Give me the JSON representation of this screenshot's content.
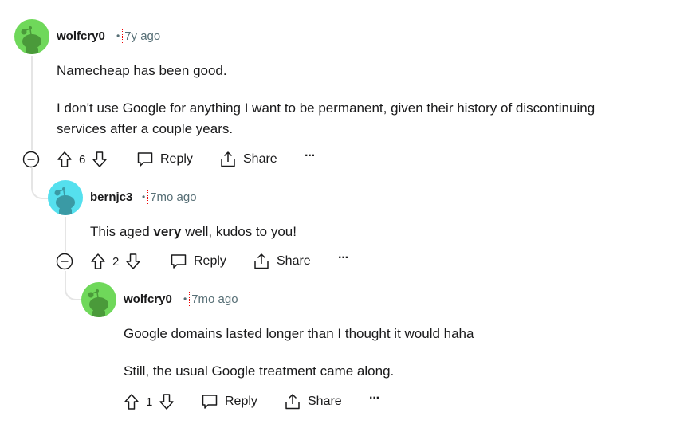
{
  "comments": [
    {
      "author": "wolfcry0",
      "time": "7y ago",
      "avatar_color": "#6fd85a",
      "avatar_fg": "#4a9a3a",
      "paragraphs": [
        "Namecheap has been good.",
        "I don't use Google for anything I want to be permanent, given their history of discontinuing",
        "services after a couple years."
      ],
      "votes": "6",
      "reply_label": "Reply",
      "share_label": "Share",
      "more_label": "···"
    },
    {
      "author": "bernjc3",
      "time": "7mo ago",
      "avatar_color": "#55e0ee",
      "avatar_fg": "#3a9aa5",
      "text_before": "This aged ",
      "text_bold": "very",
      "text_after": " well, kudos to you!",
      "votes": "2",
      "reply_label": "Reply",
      "share_label": "Share",
      "more_label": "···"
    },
    {
      "author": "wolfcry0",
      "time": "7mo ago",
      "avatar_color": "#6fd85a",
      "avatar_fg": "#4a9a3a",
      "paragraphs": [
        "Google domains lasted longer than I thought it would haha",
        "Still, the usual Google treatment came along."
      ],
      "votes": "1",
      "reply_label": "Reply",
      "share_label": "Share",
      "more_label": "···"
    }
  ]
}
